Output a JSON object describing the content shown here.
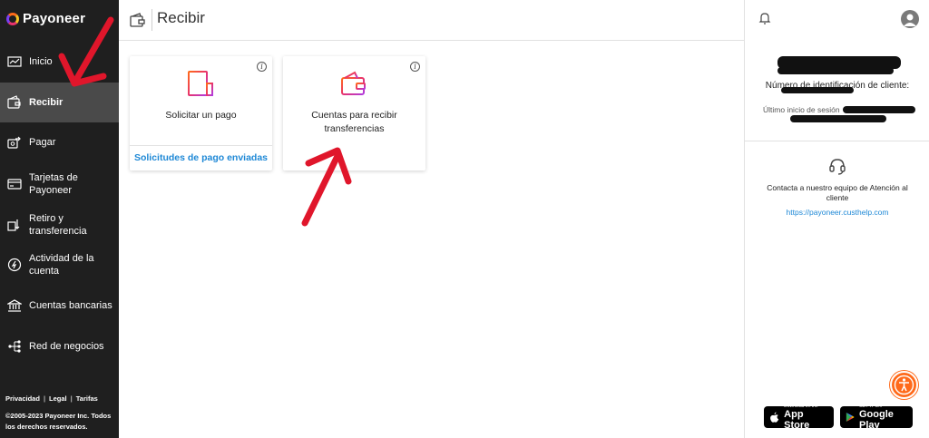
{
  "brand": {
    "name": "Payoneer"
  },
  "sidebar": {
    "items": [
      {
        "label": "Inicio",
        "icon": "chart-icon"
      },
      {
        "label": "Recibir",
        "icon": "wallet-icon",
        "active": true
      },
      {
        "label": "Pagar",
        "icon": "send-money-icon"
      },
      {
        "label": "Tarjetas de Payoneer",
        "icon": "card-icon"
      },
      {
        "label": "Retiro y transferencia",
        "icon": "withdraw-icon"
      },
      {
        "label": "Actividad de la cuenta",
        "icon": "activity-icon"
      },
      {
        "label": "Cuentas bancarias",
        "icon": "bank-icon"
      },
      {
        "label": "Red de negocios",
        "icon": "network-icon"
      }
    ],
    "footer": {
      "links": [
        "Privacidad",
        "Legal",
        "Tarifas"
      ],
      "copyright": "©2005-2023 Payoneer Inc. Todos los derechos reservados."
    }
  },
  "header": {
    "title": "Recibir",
    "icon": "wallet-icon"
  },
  "cards": [
    {
      "title": "Solicitar un pago",
      "link": "Solicitudes de pago enviadas",
      "icon": "invoice-icon"
    },
    {
      "title": "Cuentas para recibir transferencias",
      "icon": "wallet-icon"
    }
  ],
  "right_panel": {
    "client_id_label": "Número de identificación de cliente:",
    "last_login_label": "Último inicio de sesión",
    "support_text": "Contacta a nuestro equipo de Atención al cliente",
    "support_link": "https://payoneer.custhelp.com",
    "stores": [
      {
        "small": "Download on the",
        "big": "App Store"
      },
      {
        "small": "GET IT ON",
        "big": "Google Play"
      }
    ]
  },
  "colors": {
    "sidebar_bg": "#1f1f1f",
    "active_bg": "#4a4a4a",
    "link": "#1e88d6",
    "accent": "#ff6a1a",
    "annotation_arrow": "#e0162b"
  }
}
